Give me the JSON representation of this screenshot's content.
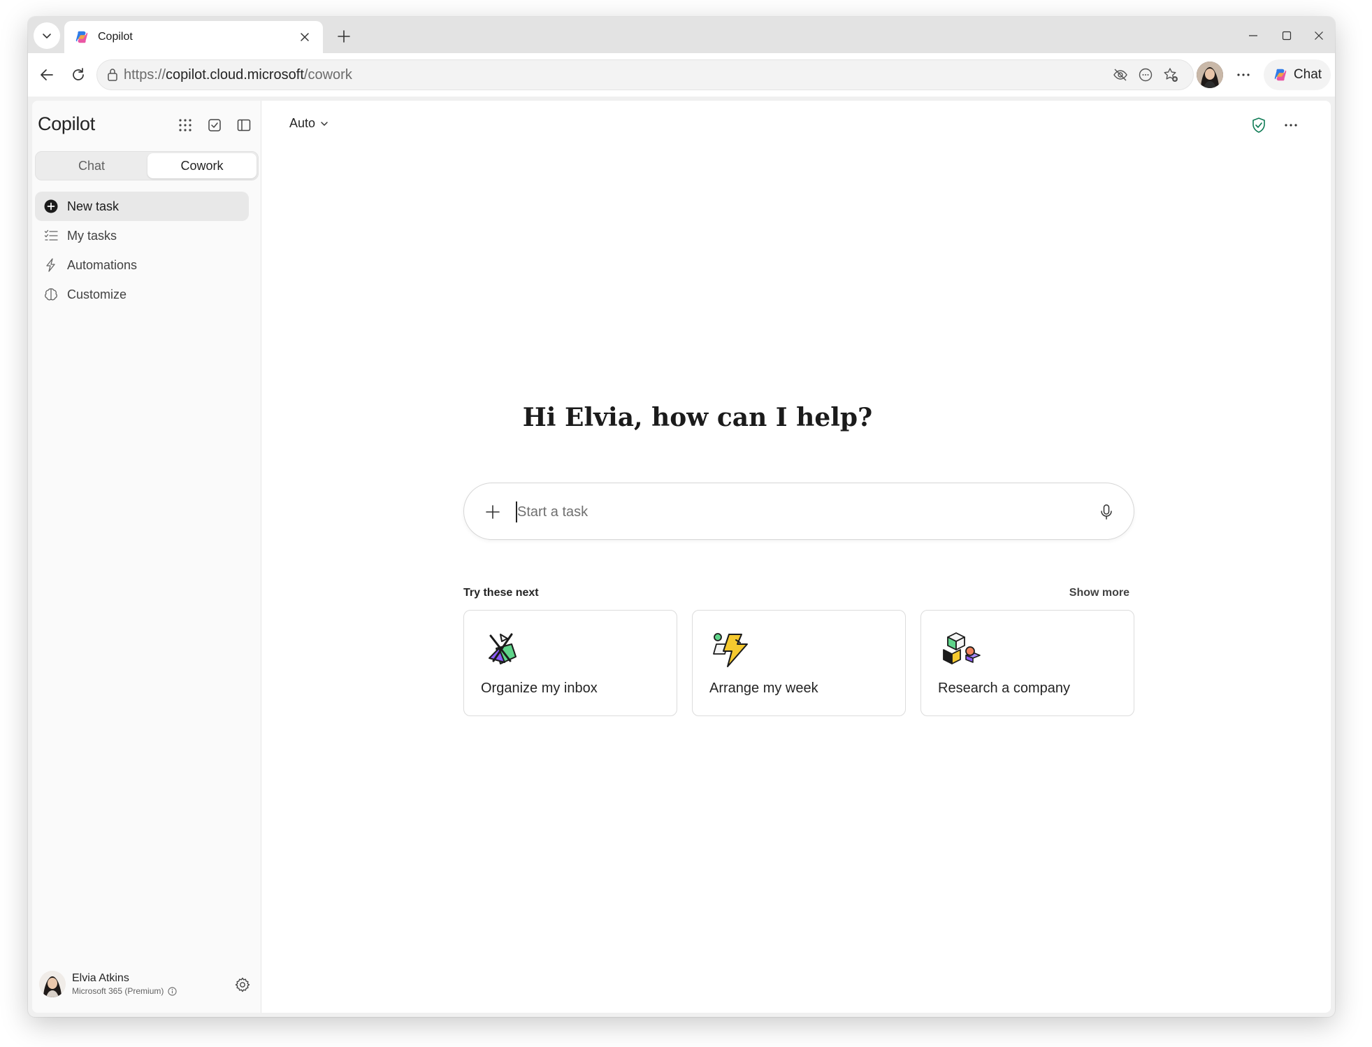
{
  "browser": {
    "tab_title": "Copilot",
    "url_scheme": "https://",
    "url_host": "copilot.cloud.microsoft",
    "url_path": "/cowork",
    "chat_button_label": "Chat"
  },
  "sidebar": {
    "brand": "Copilot",
    "segments": [
      {
        "label": "Chat",
        "active": false
      },
      {
        "label": "Cowork",
        "active": true
      }
    ],
    "nav": [
      {
        "label": "New task",
        "icon": "plus-circle-icon",
        "active": true
      },
      {
        "label": "My tasks",
        "icon": "task-list-icon",
        "active": false
      },
      {
        "label": "Automations",
        "icon": "flash-icon",
        "active": false
      },
      {
        "label": "Customize",
        "icon": "brain-icon",
        "active": false
      }
    ],
    "profile": {
      "name": "Elvia Atkins",
      "plan": "Microsoft 365 (Premium)"
    }
  },
  "main": {
    "model_selector": "Auto",
    "greeting": "Hi Elvia, how can I help?",
    "composer_placeholder": "Start a task",
    "suggestions_label": "Try these next",
    "show_more": "Show more",
    "cards": [
      {
        "title": "Organize my inbox",
        "icon": "organize-inbox-illustration"
      },
      {
        "title": "Arrange my week",
        "icon": "arrange-week-illustration"
      },
      {
        "title": "Research a company",
        "icon": "research-company-illustration"
      }
    ]
  },
  "colors": {
    "accent_green": "#0f7b55",
    "text_primary": "#242424",
    "text_secondary": "#616161"
  }
}
